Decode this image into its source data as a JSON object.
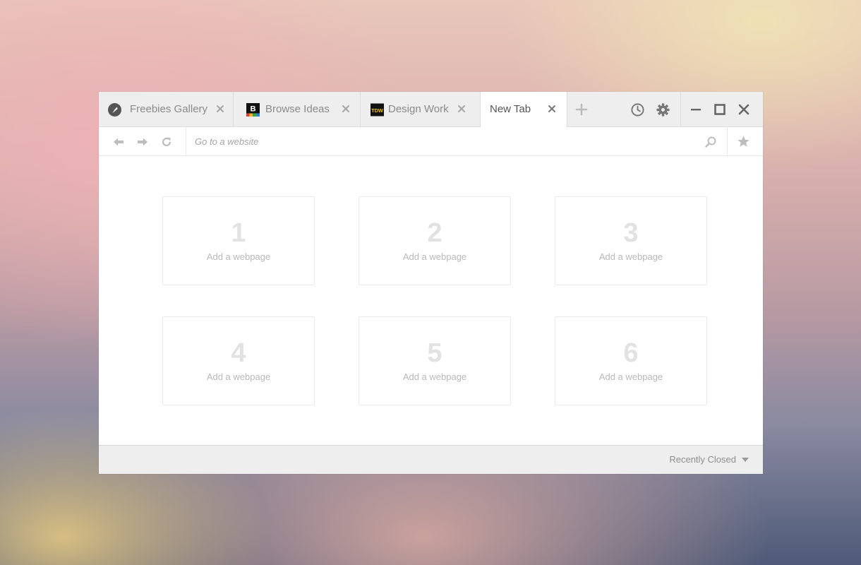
{
  "tabs": [
    {
      "title": "Freebies Gallery",
      "icon": "quill-icon",
      "active": false
    },
    {
      "title": "Browse Ideas",
      "icon": "behance-b-icon",
      "active": false
    },
    {
      "title": "Design Work",
      "icon": "tdw-logo-icon",
      "active": false
    },
    {
      "title": "New Tab",
      "icon": "",
      "active": true
    }
  ],
  "favicon_text": {
    "browse_ideas": "B",
    "design_work": "TDW"
  },
  "toolbar_icons": [
    "plus-icon",
    "history-clock-icon",
    "gear-icon",
    "minimize-icon",
    "maximize-icon",
    "close-icon"
  ],
  "address": {
    "placeholder": "Go to a website",
    "value": ""
  },
  "tiles": [
    {
      "number": "1",
      "label": "Add a webpage"
    },
    {
      "number": "2",
      "label": "Add a webpage"
    },
    {
      "number": "3",
      "label": "Add a webpage"
    },
    {
      "number": "4",
      "label": "Add a webpage"
    },
    {
      "number": "5",
      "label": "Add a webpage"
    },
    {
      "number": "6",
      "label": "Add a webpage"
    }
  ],
  "footer": {
    "recently_closed": "Recently Closed"
  },
  "colors": {
    "tabbar_bg": "#eeeeee",
    "active_tab_bg": "#ffffff",
    "icon_gray": "#777777",
    "tile_number": "#e2e2e2"
  }
}
